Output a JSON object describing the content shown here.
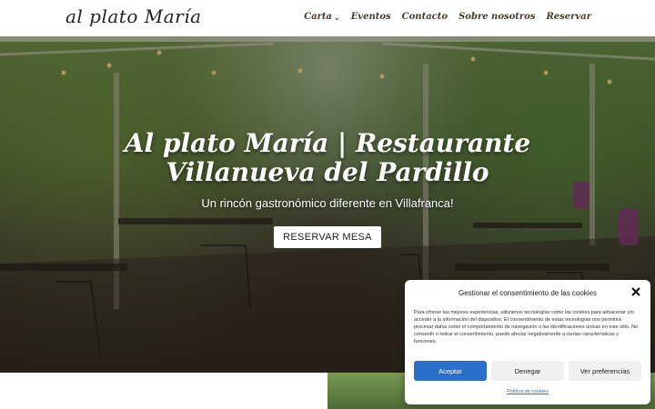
{
  "header": {
    "logo": "al plato María",
    "nav": [
      {
        "label": "Carta",
        "has_dropdown": true
      },
      {
        "label": "Eventos"
      },
      {
        "label": "Contacto"
      },
      {
        "label": "Sobre nosotros"
      },
      {
        "label": "Reservar"
      }
    ]
  },
  "hero": {
    "title": "Al plato María | Restaurante Villanueva del Pardillo",
    "subtitle": "Un rincón gastronómico diferente en Villafranca!",
    "button": "RESERVAR MESA"
  },
  "cookie_modal": {
    "title": "Gestionar el consentimiento de las cookies",
    "text": "Para ofrecer las mejores experiencias, utilizamos tecnologías como las cookies para almacenar y/o acceder a la información del dispositivo. El consentimiento de estas tecnologías nos permitirá procesar datos como el comportamiento de navegación o las identificaciones únicas en este sitio. No consentir o retirar el consentimiento, puede afectar negativamente a ciertas características y funciones.",
    "accept": "Aceptar",
    "deny": "Denegar",
    "preferences": "Ver preferencias",
    "policy_link": "Política de cookies"
  },
  "colors": {
    "accent": "#2a6fc9",
    "nav_text": "#4a3a2a"
  }
}
